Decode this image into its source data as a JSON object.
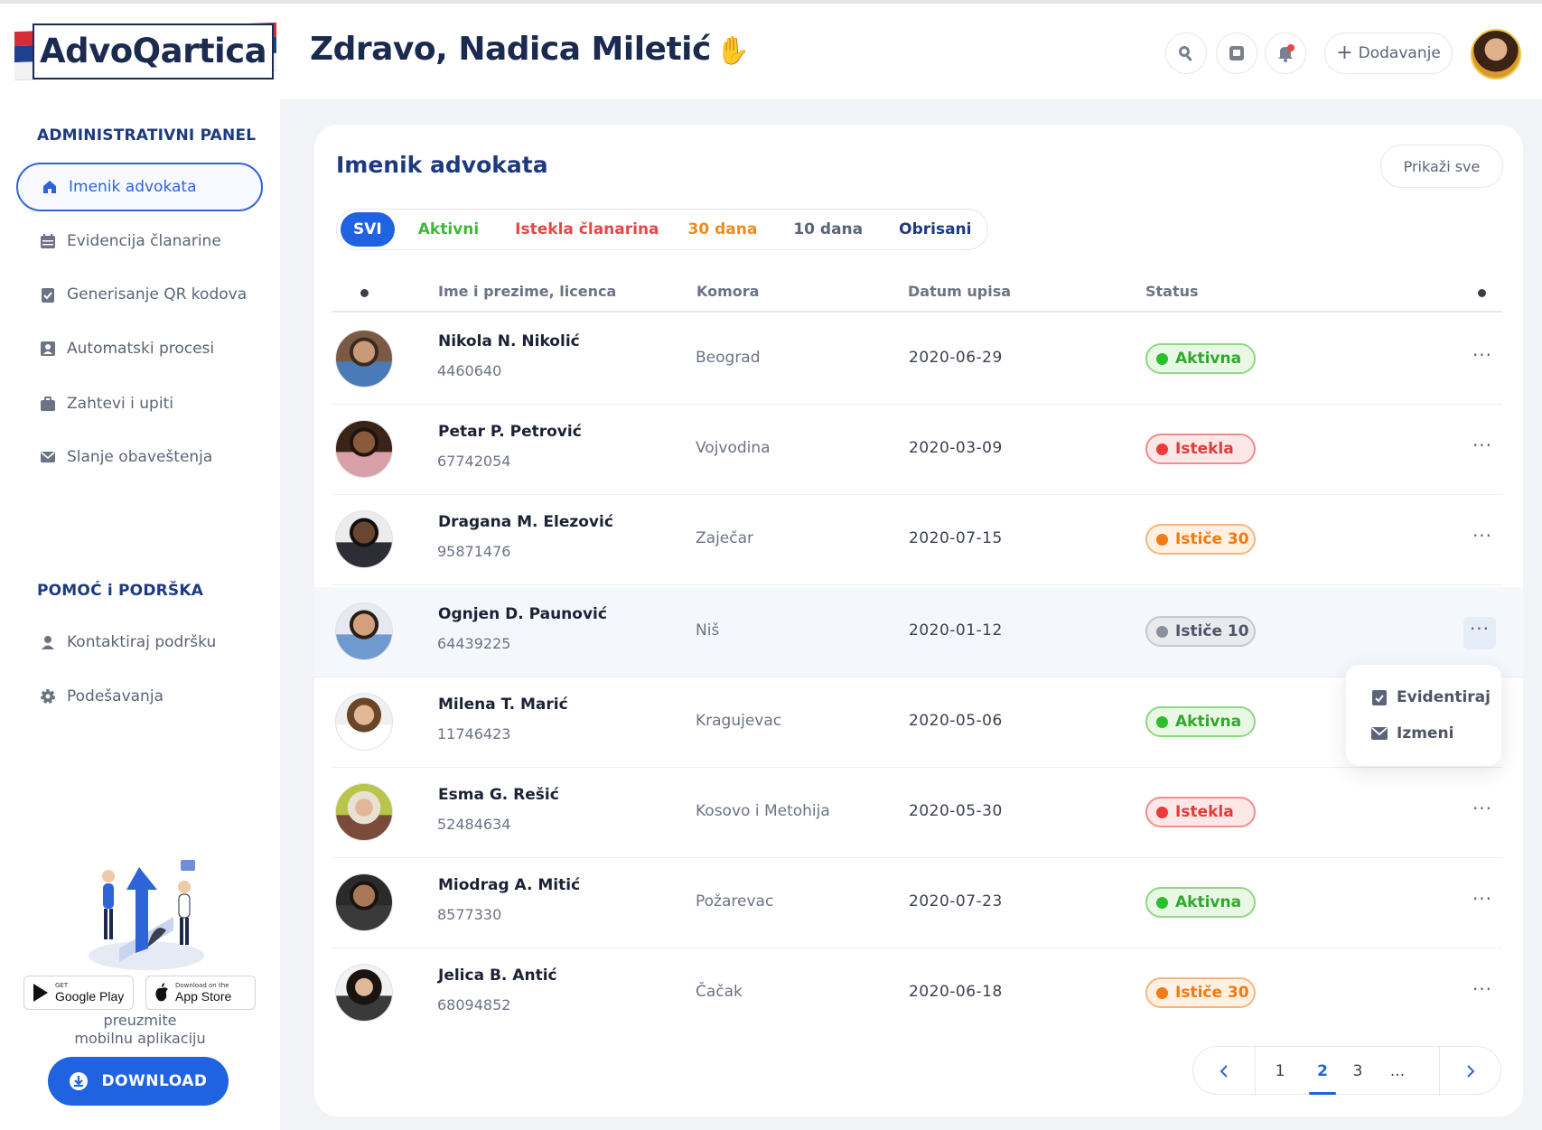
{
  "app": {
    "logo_text": "AdvoQartica",
    "greeting": "Zdravo, Nadica Miletić",
    "add_label": "Dodavanje"
  },
  "sidebar": {
    "admin_title": "ADMINISTRATIVNI PANEL",
    "items": [
      {
        "label": "Imenik advokata",
        "icon": "home-icon"
      },
      {
        "label": "Evidencija članarine",
        "icon": "calendar-icon"
      },
      {
        "label": "Generisanje QR kodova",
        "icon": "clipboard-check-icon"
      },
      {
        "label": "Automatski procesi",
        "icon": "user-card-icon"
      },
      {
        "label": "Zahtevi i upiti",
        "icon": "briefcase-icon"
      },
      {
        "label": "Slanje obaveštenja",
        "icon": "envelope-icon"
      }
    ],
    "support_title": "POMOĆ i PODRŠKA",
    "support_items": [
      {
        "label": "Kontaktiraj podršku",
        "icon": "support-agent-icon"
      },
      {
        "label": "Podešavanja",
        "icon": "gear-icon"
      }
    ],
    "google_play": {
      "small": "GET",
      "big": "Google Play"
    },
    "app_store": {
      "small": "Download on the",
      "big": "App Store"
    },
    "preuzmite_line1": "preuzmite",
    "preuzmite_line2": "mobilnu aplikaciju",
    "download_label": "DOWNLOAD"
  },
  "main": {
    "title": "Imenik advokata",
    "show_all": "Prikaži sve",
    "tabs": [
      {
        "label": "SVI",
        "color": "#ffffff"
      },
      {
        "label": "Aktivni",
        "color": "#3fb83a"
      },
      {
        "label": "Istekla članarina",
        "color": "#e84545"
      },
      {
        "label": "30 dana",
        "color": "#f08a1c"
      },
      {
        "label": "10 dana",
        "color": "#5b6478"
      },
      {
        "label": "Obrisani",
        "color": "#1d3a80"
      }
    ],
    "columns": {
      "name": "Ime i prezime, licenca",
      "chamber": "Komora",
      "date": "Datum upisa",
      "status": "Status"
    },
    "rows": [
      {
        "name": "Nikola N. Nikolić",
        "license": "4460640",
        "chamber": "Beograd",
        "date": "2020-06-29",
        "status": "Aktivna",
        "status_kind": "green"
      },
      {
        "name": "Petar P. Petrović",
        "license": "67742054",
        "chamber": "Vojvodina",
        "date": "2020-03-09",
        "status": "Istekla",
        "status_kind": "red"
      },
      {
        "name": "Dragana M. Elezović",
        "license": "95871476",
        "chamber": "Zaječar",
        "date": "2020-07-15",
        "status": "Ističe 30",
        "status_kind": "orange"
      },
      {
        "name": "Ognjen D. Paunović",
        "license": "64439225",
        "chamber": "Niš",
        "date": "2020-01-12",
        "status": "Ističe 10",
        "status_kind": "gray"
      },
      {
        "name": "Milena T. Marić",
        "license": "11746423",
        "chamber": "Kragujevac",
        "date": "2020-05-06",
        "status": "Aktivna",
        "status_kind": "green"
      },
      {
        "name": "Esma G. Rešić",
        "license": "52484634",
        "chamber": "Kosovo i Metohija",
        "date": "2020-05-30",
        "status": "Istekla",
        "status_kind": "red"
      },
      {
        "name": "Miodrag A. Mitić",
        "license": "8577330",
        "chamber": "Požarevac",
        "date": "2020-07-23",
        "status": "Aktivna",
        "status_kind": "green"
      },
      {
        "name": "Jelica B. Antić",
        "license": "68094852",
        "chamber": "Čačak",
        "date": "2020-06-18",
        "status": "Ističe 30",
        "status_kind": "orange"
      }
    ],
    "row_menu": {
      "items": [
        {
          "label": "Evidentiraj",
          "icon": "clipboard-check-icon"
        },
        {
          "label": "Izmeni",
          "icon": "envelope-icon"
        }
      ]
    },
    "pagination": {
      "pages": [
        "1",
        "2",
        "3",
        "..."
      ],
      "current": "2"
    }
  }
}
